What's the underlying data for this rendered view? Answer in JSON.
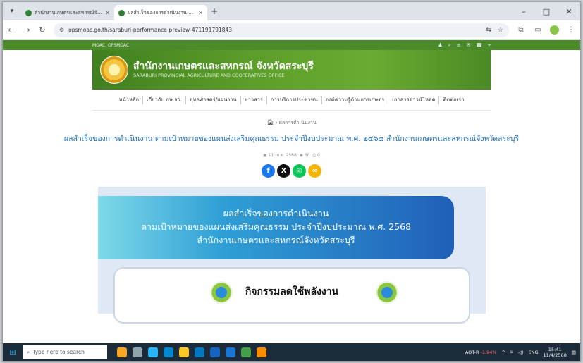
{
  "browser": {
    "tabs": [
      {
        "title": "สำนักงานเกษตรและสหกรณ์จังหวัด",
        "active": false
      },
      {
        "title": "ผลสำเร็จของการดำเนินงาน ตามเป้า",
        "active": true
      }
    ],
    "url": "opsmoac.go.th/saraburi-performance-preview-471191791843",
    "window_controls": [
      "–",
      "□",
      "✕"
    ]
  },
  "site": {
    "topstrip_links": [
      "MOAC",
      "OPSMOAC"
    ],
    "org_name_th": "สำนักงานเกษตรและสหกรณ์ จังหวัดสระบุรี",
    "org_name_en": "SARABURI PROVINCIAL AGRICULTURE AND COOPERATIVES OFFICE",
    "nav": [
      "หน้าหลัก",
      "เกี่ยวกับ กษ.จว.",
      "ยุทธศาสตร์/แผนงาน",
      "ข่าวสาร",
      "การบริการประชาชน",
      "องค์ความรู้ด้านการเกษตร",
      "เอกสารดาวน์โหลด",
      "ติดต่อเรา"
    ]
  },
  "article": {
    "breadcrumb": "ผลการดำเนินงาน",
    "title": "ผลสำเร็จของการดำเนินงาน ตามเป้าหมายของแผนส่งเสริมคุณธรรม ประจำปีงบประมาณ พ.ศ. ๒๕๖๘ สำนักงานเกษตรและสหกรณ์จังหวัดสระบุรี",
    "meta_date": "11 เม.ย. 2568",
    "meta_views": "60",
    "meta_count": "0",
    "subtitle": "ผลสำเร็จของการดำเนินงาน ตามเป้าหมายของแผนส่งเสริมคุณธรรม ประจำปีงบประมาณ พ.ศ. ๒๕๖๘"
  },
  "banner": {
    "line1": "ผลสำเร็จของการดำเนินงาน",
    "line2": "ตามเป้าหมายของแผนส่งเสริมคุณธรรม ประจำปีงบประมาณ พ.ศ. 2568",
    "line3": "สำนักงานเกษตรและสหกรณ์จังหวัดสระบุรี",
    "activity": "กิจกรรมลดใช้พลังงาน"
  },
  "taskbar": {
    "search_placeholder": "Type here to search",
    "stock": "AOT-R",
    "stock_change": "-1.94%",
    "lang": "ENG",
    "time": "15:41",
    "date": "11/4/2568"
  }
}
